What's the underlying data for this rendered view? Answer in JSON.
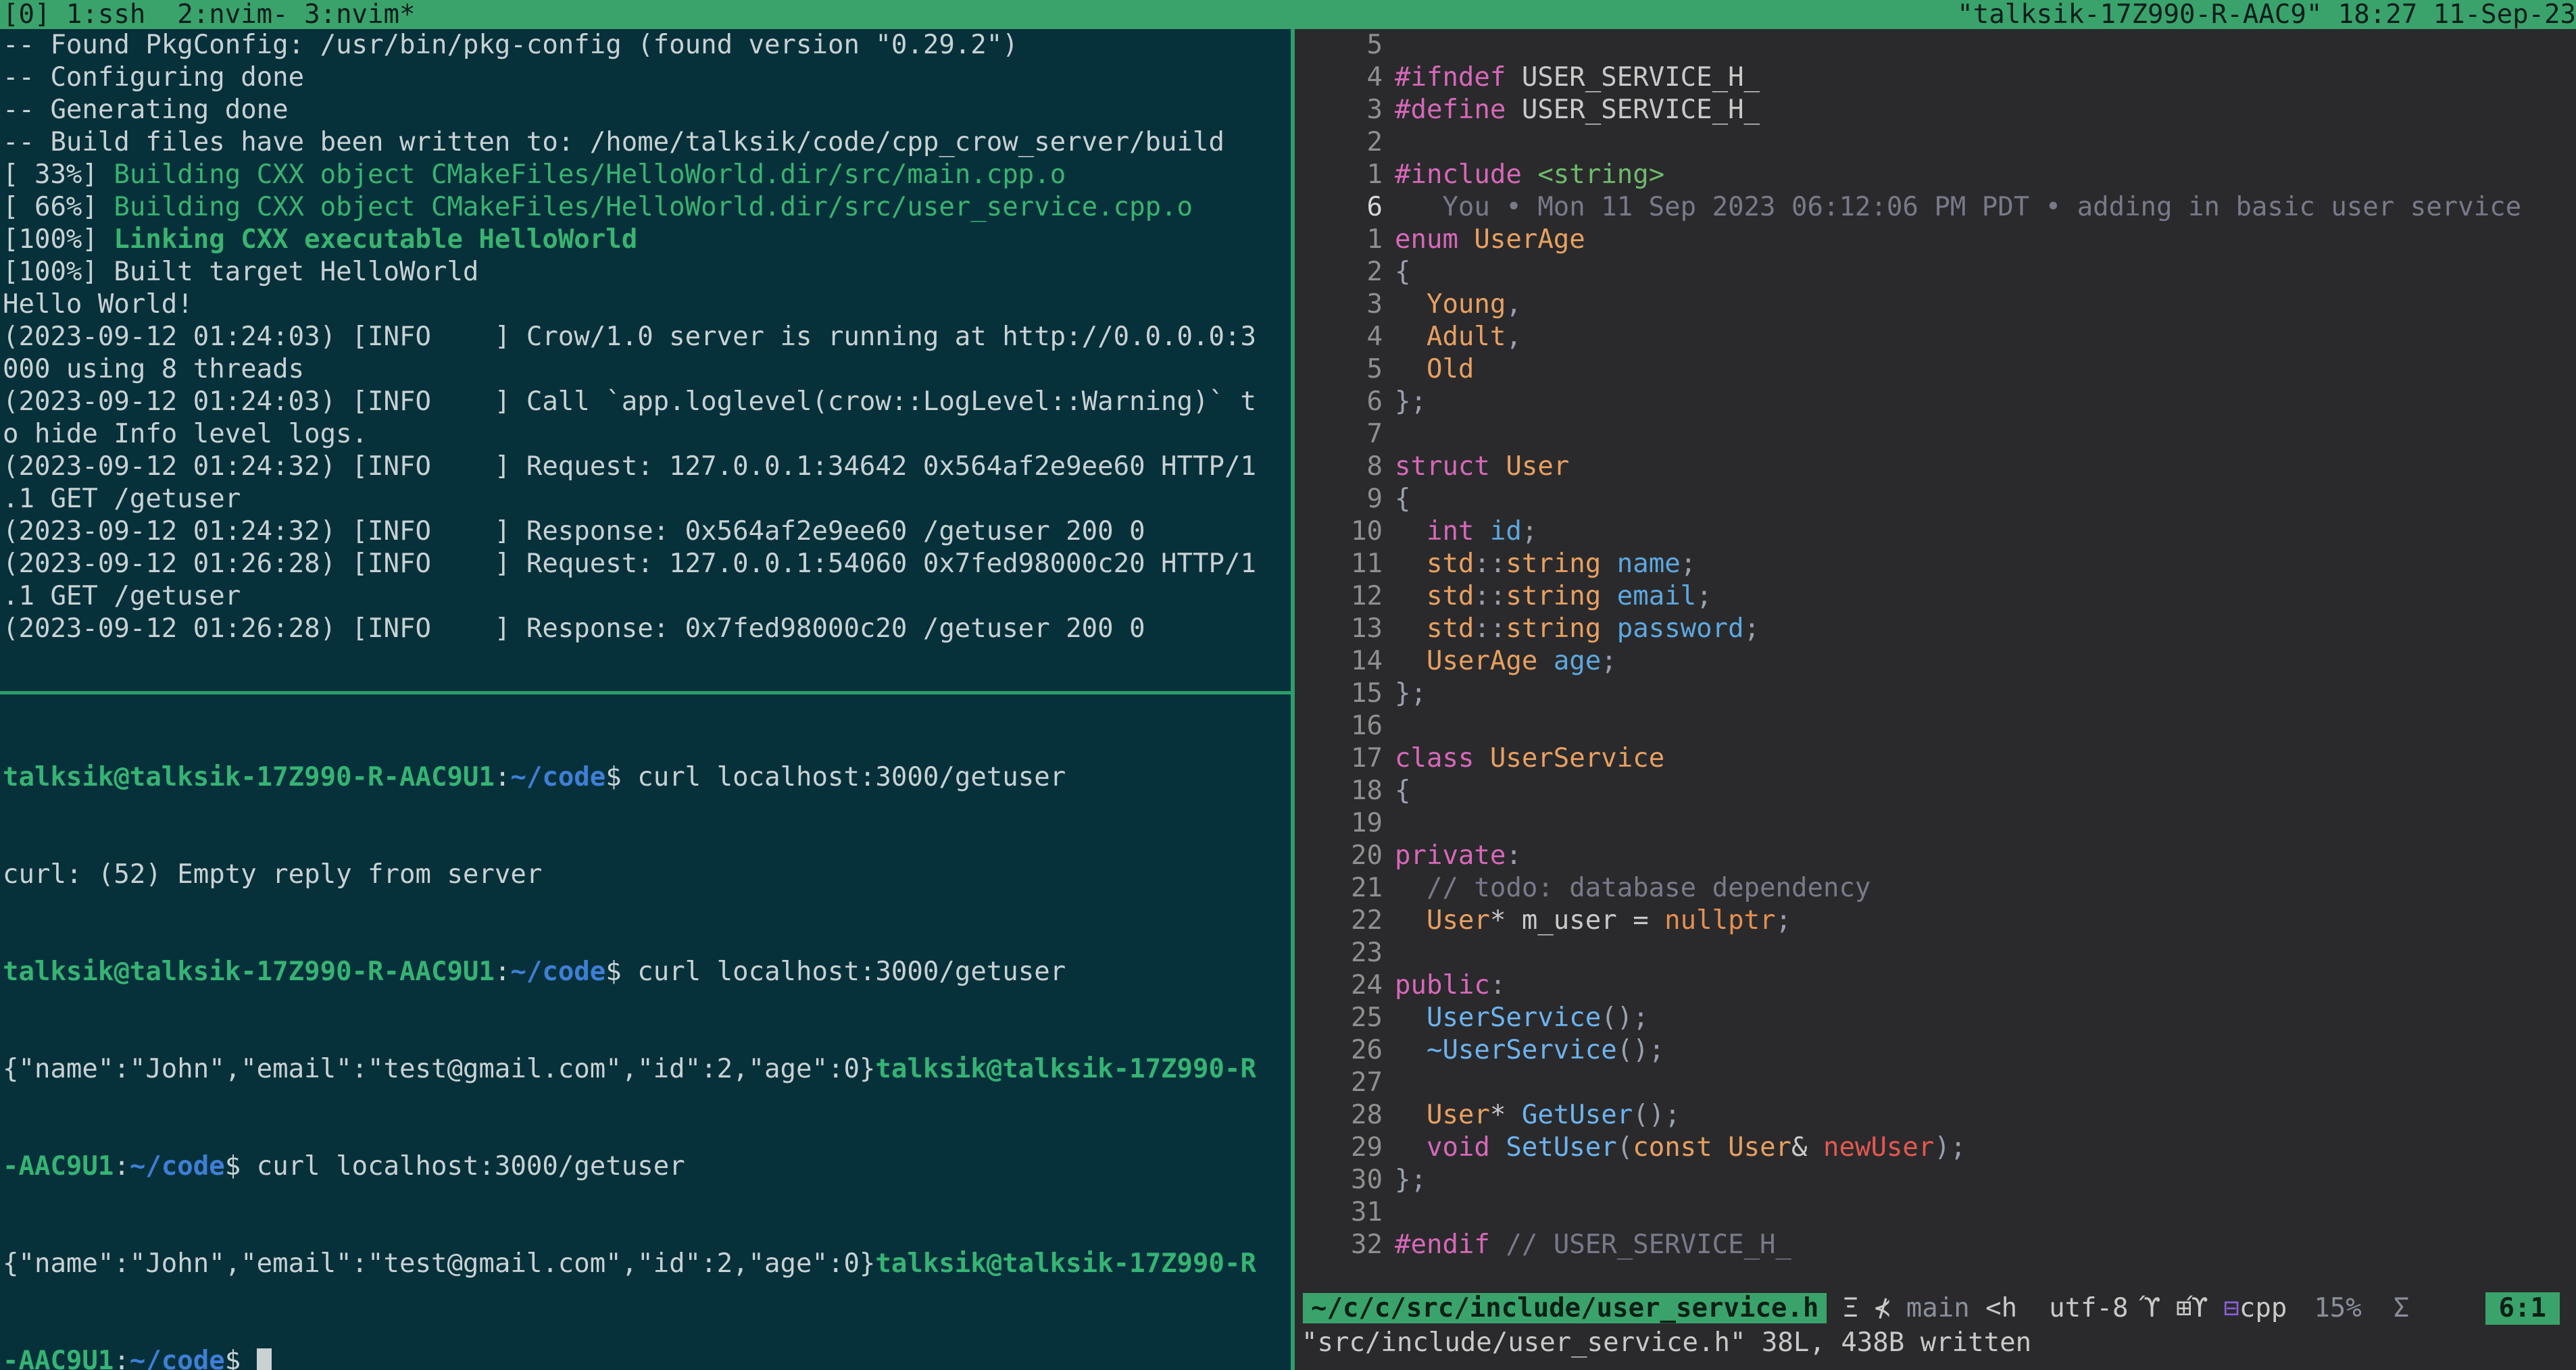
{
  "tmux": {
    "left": "[0] 1:ssh  2:nvim- 3:nvim*",
    "right": "\"talksik-17Z990-R-AAC9\" 18:27 11-Sep-23"
  },
  "log_lines": [
    {
      "text": "-- Found PkgConfig: /usr/bin/pkg-config (found version \"0.29.2\")",
      "style": ""
    },
    {
      "text": "-- Configuring done",
      "style": ""
    },
    {
      "text": "-- Generating done",
      "style": ""
    },
    {
      "text": "-- Build files have been written to: /home/talksik/code/cpp_crow_server/build",
      "style": ""
    },
    {
      "text": "[ 33%] ",
      "style": "",
      "rest": "Building CXX object CMakeFiles/HelloWorld.dir/src/main.cpp.o",
      "rest_style": "c-green"
    },
    {
      "text": "[ 66%] ",
      "style": "",
      "rest": "Building CXX object CMakeFiles/HelloWorld.dir/src/user_service.cpp.o",
      "rest_style": "c-green"
    },
    {
      "text": "[100%] ",
      "style": "",
      "rest": "Linking CXX executable HelloWorld",
      "rest_style": "c-green-b"
    },
    {
      "text": "[100%] Built target HelloWorld",
      "style": ""
    },
    {
      "text": "Hello World!",
      "style": ""
    },
    {
      "text": "(2023-09-12 01:24:03) [INFO    ] Crow/1.0 server is running at http://0.0.0.0:3",
      "style": ""
    },
    {
      "text": "000 using 8 threads",
      "style": ""
    },
    {
      "text": "(2023-09-12 01:24:03) [INFO    ] Call `app.loglevel(crow::LogLevel::Warning)` t",
      "style": ""
    },
    {
      "text": "o hide Info level logs.",
      "style": ""
    },
    {
      "text": "(2023-09-12 01:24:32) [INFO    ] Request: 127.0.0.1:34642 0x564af2e9ee60 HTTP/1",
      "style": ""
    },
    {
      "text": ".1 GET /getuser",
      "style": ""
    },
    {
      "text": "(2023-09-12 01:24:32) [INFO    ] Response: 0x564af2e9ee60 /getuser 200 0",
      "style": ""
    },
    {
      "text": "(2023-09-12 01:26:28) [INFO    ] Request: 127.0.0.1:54060 0x7fed98000c20 HTTP/1",
      "style": ""
    },
    {
      "text": ".1 GET /getuser",
      "style": ""
    },
    {
      "text": "(2023-09-12 01:26:28) [INFO    ] Response: 0x7fed98000c20 /getuser 200 0",
      "style": ""
    }
  ],
  "shell": {
    "prompt_user": "talksik@talksik-17Z990-R-AAC9U1",
    "prompt_user_a": "talksik@talksik-17Z990-R",
    "prompt_user_b": "-AAC9U1",
    "colon": ":",
    "path": "~/code",
    "dollar": "$ ",
    "cmd": "curl localhost:3000/getuser",
    "error": "curl: (52) Empty reply from server",
    "json": "{\"name\":\"John\",\"email\":\"test@gmail.com\",\"id\":2,\"age\":0}"
  },
  "editor": {
    "lines": [
      {
        "n": "5",
        "tokens": []
      },
      {
        "n": "4",
        "tokens": [
          [
            "kw-pink",
            "#ifndef "
          ],
          [
            "plain",
            "USER_SERVICE_H_"
          ]
        ]
      },
      {
        "n": "3",
        "tokens": [
          [
            "kw-pink",
            "#define "
          ],
          [
            "plain",
            "USER_SERVICE_H_"
          ]
        ]
      },
      {
        "n": "2",
        "tokens": []
      },
      {
        "n": "1",
        "tokens": [
          [
            "kw-pink",
            "#include "
          ],
          [
            "str-green",
            "<string>"
          ]
        ]
      },
      {
        "n": "6",
        "cur": true,
        "tokens": [
          [
            "blame",
            "   You • Mon 11 Sep 2023 06:12:06 PM PDT • adding in basic user service"
          ]
        ]
      },
      {
        "n": "1",
        "tokens": [
          [
            "kw-pink",
            "enum "
          ],
          [
            "type-orange",
            "UserAge"
          ]
        ]
      },
      {
        "n": "2",
        "tokens": [
          [
            "punc",
            "{"
          ]
        ]
      },
      {
        "n": "3",
        "tokens": [
          [
            "type-orange",
            "  Young"
          ],
          [
            "punc",
            ","
          ]
        ]
      },
      {
        "n": "4",
        "tokens": [
          [
            "type-orange",
            "  Adult"
          ],
          [
            "punc",
            ","
          ]
        ]
      },
      {
        "n": "5",
        "tokens": [
          [
            "type-orange",
            "  Old"
          ]
        ]
      },
      {
        "n": "6",
        "tokens": [
          [
            "punc",
            "};"
          ]
        ]
      },
      {
        "n": "7",
        "tokens": []
      },
      {
        "n": "8",
        "tokens": [
          [
            "kw-pink",
            "struct "
          ],
          [
            "type-orange",
            "User"
          ]
        ]
      },
      {
        "n": "9",
        "tokens": [
          [
            "punc",
            "{"
          ]
        ]
      },
      {
        "n": "10",
        "tokens": [
          [
            "kw-pink",
            "  int "
          ],
          [
            "ident-blue",
            "id"
          ],
          [
            "punc",
            ";"
          ]
        ]
      },
      {
        "n": "11",
        "tokens": [
          [
            "type-orange",
            "  std"
          ],
          [
            "punc",
            "::"
          ],
          [
            "type-orange",
            "string "
          ],
          [
            "ident-blue",
            "name"
          ],
          [
            "punc",
            ";"
          ]
        ]
      },
      {
        "n": "12",
        "tokens": [
          [
            "type-orange",
            "  std"
          ],
          [
            "punc",
            "::"
          ],
          [
            "type-orange",
            "string "
          ],
          [
            "ident-blue",
            "email"
          ],
          [
            "punc",
            ";"
          ]
        ]
      },
      {
        "n": "13",
        "tokens": [
          [
            "type-orange",
            "  std"
          ],
          [
            "punc",
            "::"
          ],
          [
            "type-orange",
            "string "
          ],
          [
            "ident-blue",
            "password"
          ],
          [
            "punc",
            ";"
          ]
        ]
      },
      {
        "n": "14",
        "tokens": [
          [
            "type-orange",
            "  UserAge "
          ],
          [
            "ident-blue",
            "age"
          ],
          [
            "punc",
            ";"
          ]
        ]
      },
      {
        "n": "15",
        "tokens": [
          [
            "punc",
            "};"
          ]
        ]
      },
      {
        "n": "16",
        "tokens": []
      },
      {
        "n": "17",
        "tokens": [
          [
            "kw-pink",
            "class "
          ],
          [
            "type-orange",
            "UserService"
          ]
        ]
      },
      {
        "n": "18",
        "tokens": [
          [
            "punc",
            "{"
          ]
        ]
      },
      {
        "n": "19",
        "tokens": []
      },
      {
        "n": "20",
        "tokens": [
          [
            "kw-pink",
            "private"
          ],
          [
            "punc",
            ":"
          ]
        ]
      },
      {
        "n": "21",
        "tokens": [
          [
            "cmt",
            "  // todo: database dependency"
          ]
        ]
      },
      {
        "n": "22",
        "tokens": [
          [
            "type-orange",
            "  User"
          ],
          [
            "plain",
            "* m_user = "
          ],
          [
            "kw-orange",
            "nullptr"
          ],
          [
            "punc",
            ";"
          ]
        ]
      },
      {
        "n": "23",
        "tokens": []
      },
      {
        "n": "24",
        "tokens": [
          [
            "kw-pink",
            "public"
          ],
          [
            "punc",
            ":"
          ]
        ]
      },
      {
        "n": "25",
        "tokens": [
          [
            "fn-blue",
            "  UserService"
          ],
          [
            "punc",
            "();"
          ]
        ]
      },
      {
        "n": "26",
        "tokens": [
          [
            "fn-blue",
            "  ~UserService"
          ],
          [
            "punc",
            "();"
          ]
        ]
      },
      {
        "n": "27",
        "tokens": []
      },
      {
        "n": "28",
        "tokens": [
          [
            "type-orange",
            "  User"
          ],
          [
            "plain",
            "* "
          ],
          [
            "fn-blue",
            "GetUser"
          ],
          [
            "punc",
            "();"
          ]
        ]
      },
      {
        "n": "29",
        "tokens": [
          [
            "kw-pink",
            "  void "
          ],
          [
            "fn-blue",
            "SetUser"
          ],
          [
            "punc",
            "("
          ],
          [
            "type-orange",
            "const User"
          ],
          [
            "plain",
            "& "
          ],
          [
            "red",
            "newUser"
          ],
          [
            "punc",
            ");"
          ]
        ]
      },
      {
        "n": "30",
        "tokens": [
          [
            "punc",
            "};"
          ]
        ]
      },
      {
        "n": "31",
        "tokens": []
      },
      {
        "n": "32",
        "tokens": [
          [
            "kw-pink",
            "#endif "
          ],
          [
            "cmt",
            "// USER_SERVICE_H_"
          ]
        ]
      }
    ]
  },
  "statusline": {
    "file": "~/c/c/src/include/user_service.h",
    "git": " Ξ ⊀ ",
    "branch": "main",
    "h": " <h  ",
    "enc": "utf-8 ϓ ",
    "icons": "⊞ϓ ",
    "ft_icon": "⊟",
    "ft": "cpp",
    "pct": "15%  Σ",
    "pos": "6:1"
  },
  "cmdline": "\"src/include/user_service.h\" 38L, 438B written"
}
